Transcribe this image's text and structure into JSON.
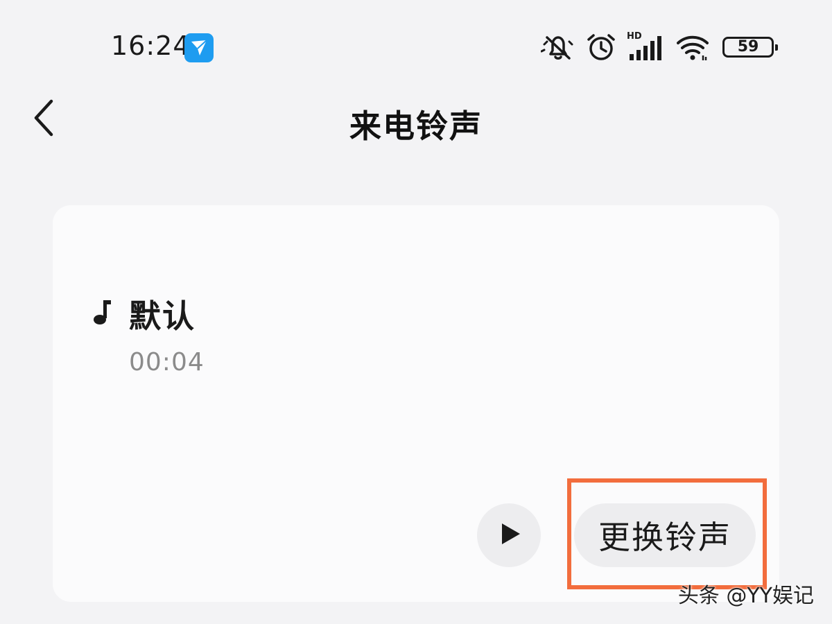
{
  "status_bar": {
    "time": "16:24",
    "app_icon": "paper-plane-icon",
    "icons": [
      "mute-bell-icon",
      "alarm-clock-icon",
      "hd-signal-icon",
      "wifi-icon"
    ],
    "hd_label": "HD",
    "battery_level": "59"
  },
  "header": {
    "back_icon": "back-chevron-icon",
    "title": "来电铃声"
  },
  "ringtone": {
    "icon": "music-note-icon",
    "name": "默认",
    "duration": "00:04"
  },
  "actions": {
    "play_icon": "play-icon",
    "change_label": "更换铃声"
  },
  "annotation": {
    "highlight_color": "#f26d3d"
  },
  "watermark": {
    "text": "头条 @YY娱记"
  }
}
